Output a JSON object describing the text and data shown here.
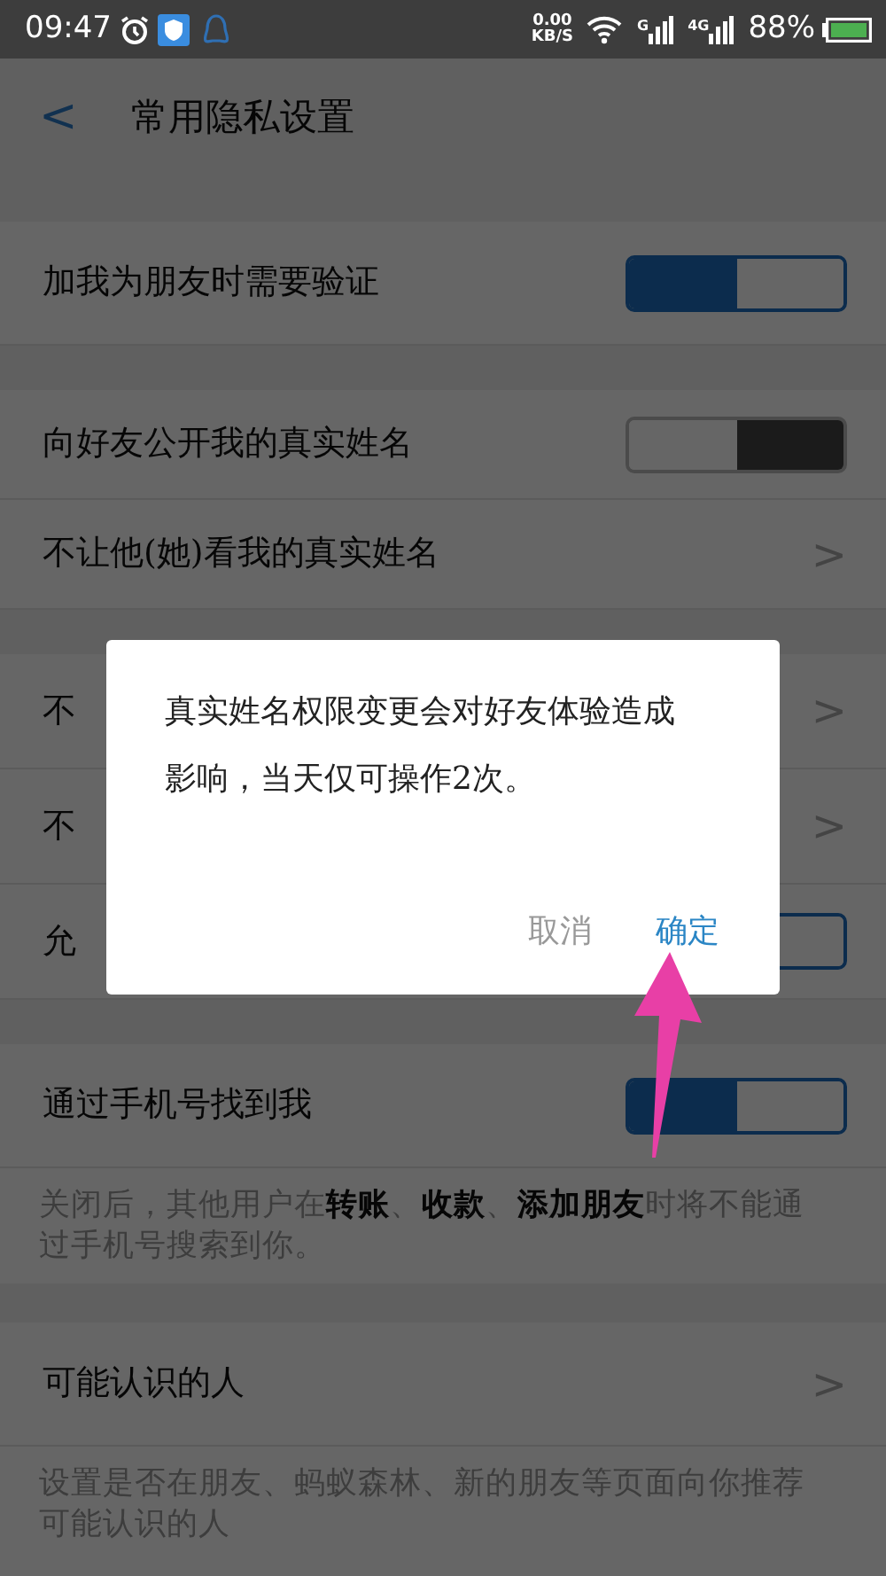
{
  "status_bar": {
    "time": "09:47",
    "speed": "0.00",
    "speed_unit": "KB/S",
    "network_1": "G",
    "network_2": "4G",
    "battery": "88%"
  },
  "header": {
    "back": "<",
    "title": "常用隐私设置"
  },
  "sections": [
    {
      "rows": [
        {
          "kind": "toggle",
          "label": "加我为朋友时需要验证",
          "on": true
        }
      ]
    },
    {
      "rows": [
        {
          "kind": "toggle",
          "label": "向好友公开我的真实姓名",
          "on": false
        },
        {
          "kind": "link",
          "label": "不让他(她)看我的真实姓名",
          "chevron": ">"
        }
      ]
    },
    {
      "rows": [
        {
          "kind": "link",
          "label": "不",
          "chevron": ">"
        },
        {
          "kind": "link",
          "label": "不",
          "chevron": ">"
        },
        {
          "kind": "toggle",
          "label": "允",
          "on": true
        }
      ]
    },
    {
      "rows": [
        {
          "kind": "toggle",
          "label": "通过手机号找到我",
          "on": true
        }
      ],
      "note": "关闭后，其他用户在**转账**、**收款**、**添加朋友**时将不能通过手机号搜索到你。"
    },
    {
      "rows": [
        {
          "kind": "link",
          "label": "可能认识的人",
          "chevron": ">"
        }
      ],
      "note": "设置是否在朋友、蚂蚁森林、新的朋友等页面向你推荐可能认识的人"
    }
  ],
  "dialog": {
    "message": "真实姓名权限变更会对好友体验造成影响，当天仅可操作2次。",
    "buttons": [
      {
        "label": "取消",
        "kind": "cancel"
      },
      {
        "label": "确定",
        "kind": "confirm"
      }
    ]
  }
}
